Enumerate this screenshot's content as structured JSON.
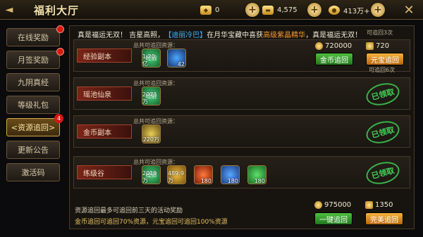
{
  "header": {
    "title": "福利大厅",
    "res": [
      {
        "icon": "ingot-icon",
        "value": "0"
      },
      {
        "icon": "gold-bar-icon",
        "value": "4,575"
      },
      {
        "icon": "coin-icon",
        "value": "413万+"
      }
    ]
  },
  "sidebar": [
    {
      "label": "在线奖励",
      "dot": true
    },
    {
      "label": "月签奖励",
      "dot": true
    },
    {
      "label": "九阴真经",
      "dot": false
    },
    {
      "label": "等级礼包",
      "dot": false
    },
    {
      "label": "<资源追回>",
      "active": true,
      "badge": "4"
    },
    {
      "label": "更新公告",
      "dot": false
    },
    {
      "label": "激活码",
      "dot": false
    }
  ],
  "ticker": {
    "a": "真是福运无双！ 吉星高照，",
    "b": "【迪丽冷巴】",
    "c": "在月华宝藏中喜获",
    "d": "高级紫晶精华",
    "e": "，真是福运无双！",
    "right": "可追回3次"
  },
  "rows": [
    {
      "tag": "经验副本",
      "sub": "总共可追回资源：",
      "items": [
        {
          "t": "经验",
          "n": "1.20亿"
        },
        {
          "t": "",
          "n": "42"
        }
      ],
      "gold_price": "720000",
      "gold_btn": "金币追回",
      "ingot_price": "720",
      "ingot_btn": "元宝追回",
      "times": "可追回6次"
    },
    {
      "tag": "瑶池仙泉",
      "sub": "总共可追回资源：",
      "items": [
        {
          "t": "经验",
          "n": "2073万"
        }
      ],
      "stamp": "已领取"
    },
    {
      "tag": "金币副本",
      "sub": "总共可追回资源：",
      "items": [
        {
          "t": "",
          "n": "220万"
        }
      ],
      "stamp": "已领取"
    },
    {
      "tag": "练级谷",
      "sub": "总共可追回资源：",
      "items": [
        {
          "t": "经验",
          "n": "2019万"
        },
        {
          "t": "",
          "n": "489.9万"
        },
        {
          "t": "",
          "n": "180"
        },
        {
          "t": "",
          "n": "180"
        },
        {
          "t": "",
          "n": "180"
        }
      ],
      "stamp": "已领取"
    }
  ],
  "footer": {
    "l1": "资源追回最多可追回前三天的活动奖励",
    "l2": "金币追回可追回70%资源，元宝追回可追回100%资源",
    "gold": "975000",
    "gold_btn": "一键追回",
    "ingot": "1350",
    "ingot_btn": "完美追回"
  },
  "colors": {
    "accent": "#d8a94a",
    "green": "#39b14a"
  }
}
